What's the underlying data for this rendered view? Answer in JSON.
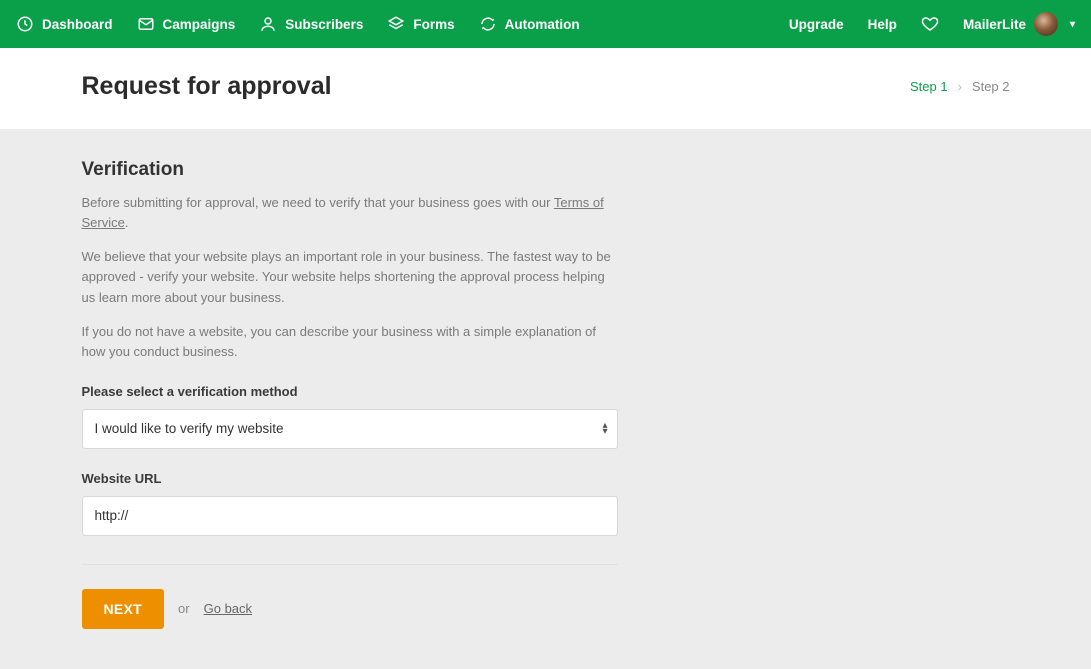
{
  "nav": {
    "dashboard": "Dashboard",
    "campaigns": "Campaigns",
    "subscribers": "Subscribers",
    "forms": "Forms",
    "automation": "Automation",
    "upgrade": "Upgrade",
    "help": "Help",
    "brand": "MailerLite"
  },
  "header": {
    "title": "Request for approval",
    "step1": "Step 1",
    "step2": "Step 2"
  },
  "verification": {
    "title": "Verification",
    "para1_pre": "Before submitting for approval, we need to verify that your business goes with our ",
    "tos": "Terms of Service",
    "para1_post": ".",
    "para2": "We believe that your website plays an important role in your business. The fastest way to be approved - verify your website. Your website helps shortening the approval process helping us learn more about your business.",
    "para3": "If you do not have a website, you can describe your business with a simple explanation of how you conduct business.",
    "method_label": "Please select a verification method",
    "method_value": "I would like to verify my website",
    "url_label": "Website URL",
    "url_value": "http://"
  },
  "actions": {
    "next": "NEXT",
    "or": "or",
    "go_back": "Go back"
  }
}
